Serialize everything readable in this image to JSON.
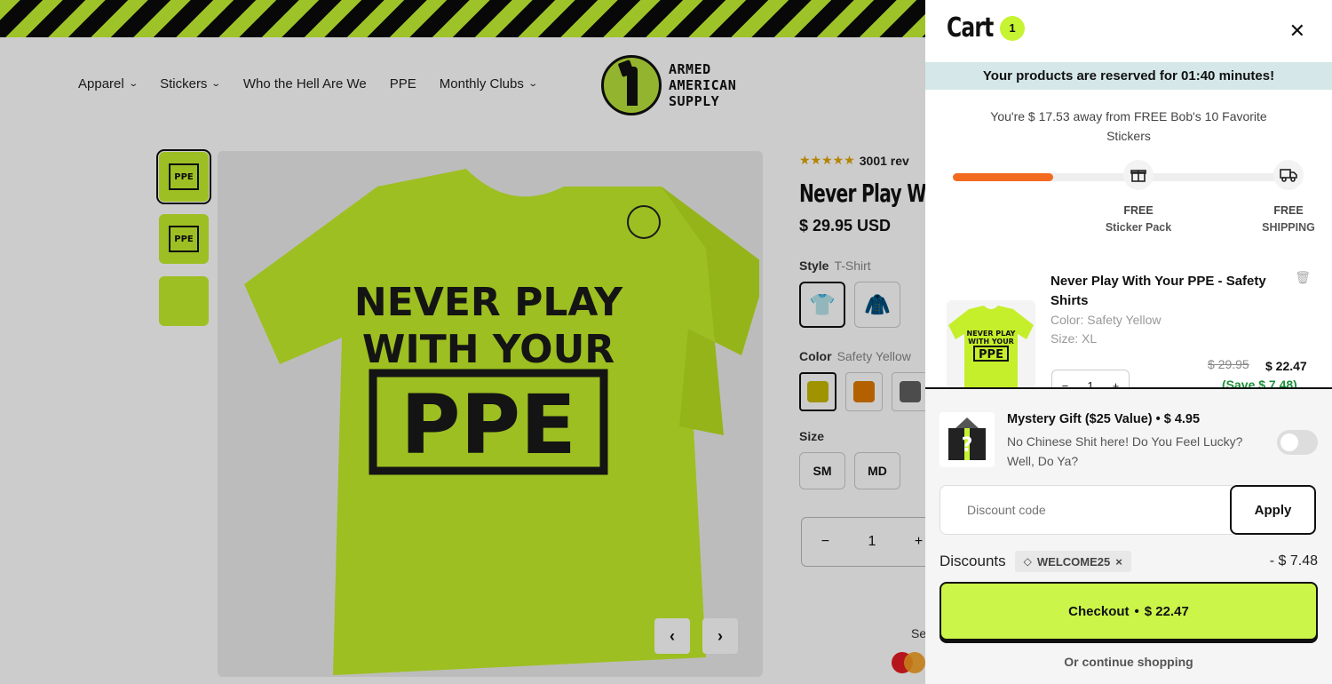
{
  "nav": {
    "items": [
      {
        "label": "Apparel",
        "has_dropdown": true
      },
      {
        "label": "Stickers",
        "has_dropdown": true
      },
      {
        "label": "Who the Hell Are We",
        "has_dropdown": false
      },
      {
        "label": "PPE",
        "has_dropdown": false
      },
      {
        "label": "Monthly Clubs",
        "has_dropdown": true
      }
    ],
    "logo": {
      "line1": "ARMED",
      "line2": "AMERICAN",
      "line3": "SUPPLY"
    }
  },
  "product": {
    "reviews": "3001 rev",
    "title": "Never Play Wit",
    "price": "$ 29.95 USD",
    "style_label": "Style",
    "style_value": "T-Shirt",
    "color_label": "Color",
    "color_value": "Safety Yellow",
    "size_label": "Size",
    "sizes": [
      "SM",
      "MD"
    ],
    "quantity": "1",
    "shirt_text": {
      "line1": "NEVER PLAY",
      "line2": "WITH YOUR",
      "line3": "PPE"
    },
    "se_text": "Se",
    "swatch_colors": [
      "#c9b800",
      "#e07a00",
      "#606060"
    ]
  },
  "cart": {
    "title": "Cart",
    "count": "1",
    "reserve_text": "Your products are reserved for 01:40 minutes!",
    "away_text": "You're $ 17.53 away from FREE Bob's 10 Favorite Stickers",
    "progress_fraction": 0.29,
    "milestones": [
      {
        "top": "FREE",
        "bottom": "Sticker Pack",
        "icon": "gift-icon"
      },
      {
        "top": "FREE",
        "bottom": "SHIPPING",
        "icon": "truck-icon"
      }
    ],
    "item": {
      "name": "Never Play With Your PPE - Safety Shirts",
      "color": "Color: Safety Yellow",
      "size": "Size: XL",
      "old_price": "$ 29.95",
      "price": "$ 22.47",
      "save": "(Save $ 7.48)",
      "quantity": "1"
    },
    "upsell": {
      "name": "Mystery Gift ($25 Value)",
      "price": "• $ 4.95",
      "description": "No Chinese Shit here!  Do You Feel Lucky? Well, Do Ya?"
    },
    "discount_placeholder": "Discount code",
    "apply_label": "Apply",
    "discounts_label": "Discounts",
    "discount_code": "WELCOME25",
    "discount_amount": "- $ 7.48",
    "checkout_label": "Checkout",
    "checkout_sep": "•",
    "checkout_total": "$ 22.47",
    "continue_label": "Or continue shopping"
  },
  "colors": {
    "accent": "#c6f432",
    "progress": "#f26a20",
    "banner": "#d5e7e9",
    "save_green": "#1d8f3a"
  }
}
